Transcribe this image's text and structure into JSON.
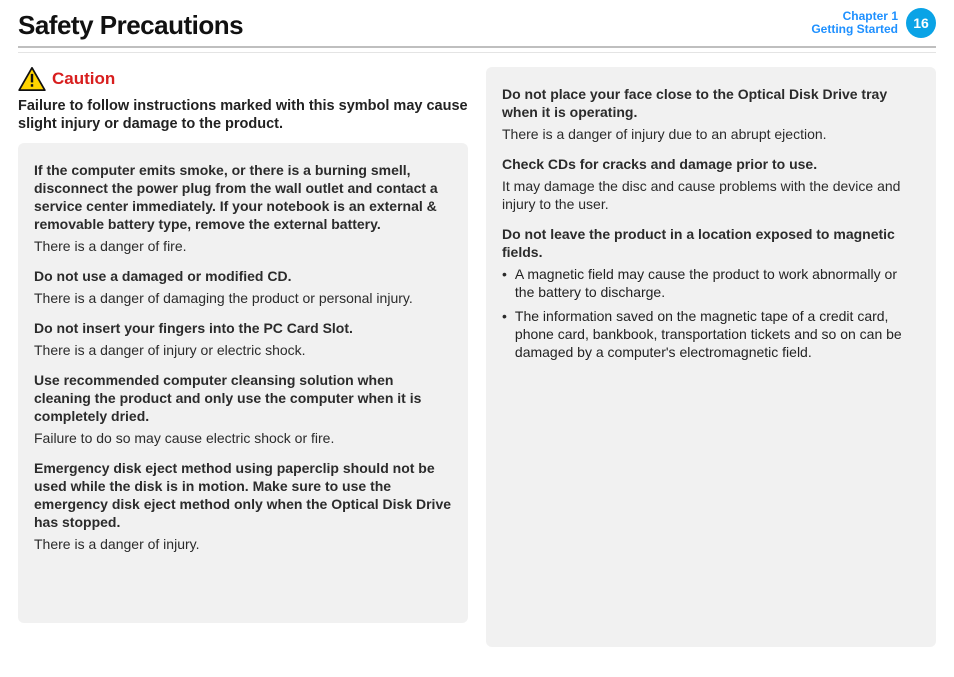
{
  "header": {
    "page_title": "Safety Precautions",
    "chapter_line1": "Chapter 1",
    "chapter_line2": "Getting Started",
    "page_number": "16"
  },
  "caution": {
    "heading": "Caution",
    "intro": "Failure to follow instructions marked with this symbol may cause slight injury or damage to the product."
  },
  "left_box": {
    "p1_bold": "If the computer emits smoke, or there is a burning smell, disconnect the power plug from the wall outlet and contact a service center immediately. If your notebook is an external & removable battery type, remove the external battery.",
    "p1_body": "There is a danger of fire.",
    "p2_bold": "Do not use a damaged or modified CD.",
    "p2_body": "There is a danger of damaging the product or personal injury.",
    "p3_bold": "Do not insert your fingers into the PC Card Slot.",
    "p3_body": "There is a danger of injury or electric shock.",
    "p4_bold": "Use recommended computer cleansing solution when cleaning the product and only use the computer when it is completely dried.",
    "p4_body": "Failure to do so may cause electric shock or fire.",
    "p5_bold": "Emergency disk eject method using paperclip should not be used while the disk is in motion. Make sure to use the emergency disk eject method only when the Optical Disk Drive has stopped.",
    "p5_body": "There is a danger of injury."
  },
  "right_box": {
    "p6_bold": "Do not place your face close to the Optical Disk Drive tray when it is operating.",
    "p6_body": "There is a danger of injury due to an abrupt ejection.",
    "p7_bold": "Check CDs for cracks and damage prior to use.",
    "p7_body": "It may damage the disc and cause problems with the device and injury to the user.",
    "p8_bold": "Do not leave the product in a location exposed to magnetic fields.",
    "bullets": [
      "A magnetic field may cause the product to work abnormally or the battery to discharge.",
      "The information saved on the magnetic tape of a credit card, phone card, bankbook, transportation tickets and so on can be damaged by a computer's electromagnetic field."
    ]
  }
}
